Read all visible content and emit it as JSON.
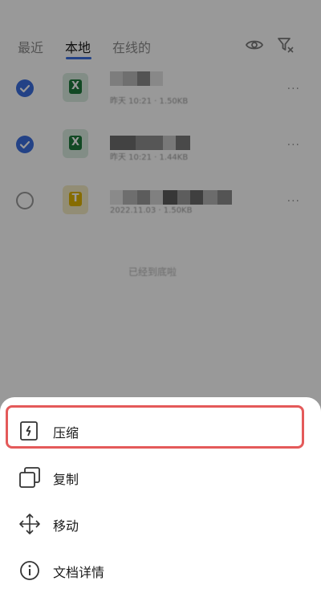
{
  "tabs": [
    {
      "label": "最近",
      "active": false
    },
    {
      "label": "本地",
      "active": true
    },
    {
      "label": "在线的",
      "active": false
    }
  ],
  "header_icons": [
    "eye-icon",
    "filter-icon"
  ],
  "files": [
    {
      "checked": true,
      "type": "excel",
      "icon_letter": "X",
      "icon_color": "#1e7b3d",
      "meta": "昨天 10:21 · 1.50KB"
    },
    {
      "checked": true,
      "type": "excel",
      "icon_letter": "X",
      "icon_color": "#1e7b3d",
      "meta": "昨天 10:21 · 1.44KB"
    },
    {
      "checked": false,
      "type": "text",
      "icon_letter": "T",
      "icon_color": "#e0b400",
      "meta": "2022.11.03 · 1.50KB"
    }
  ],
  "more_label": "···",
  "empty_note": "已经到底啦",
  "menu": [
    {
      "label": "压缩",
      "icon": "compress-icon",
      "highlighted": true
    },
    {
      "label": "复制",
      "icon": "copy-icon",
      "highlighted": false
    },
    {
      "label": "移动",
      "icon": "move-icon",
      "highlighted": false
    },
    {
      "label": "文档详情",
      "icon": "info-icon",
      "highlighted": false
    }
  ],
  "colors": {
    "accent": "#3b6fe0",
    "highlight": "#e45a5a"
  }
}
